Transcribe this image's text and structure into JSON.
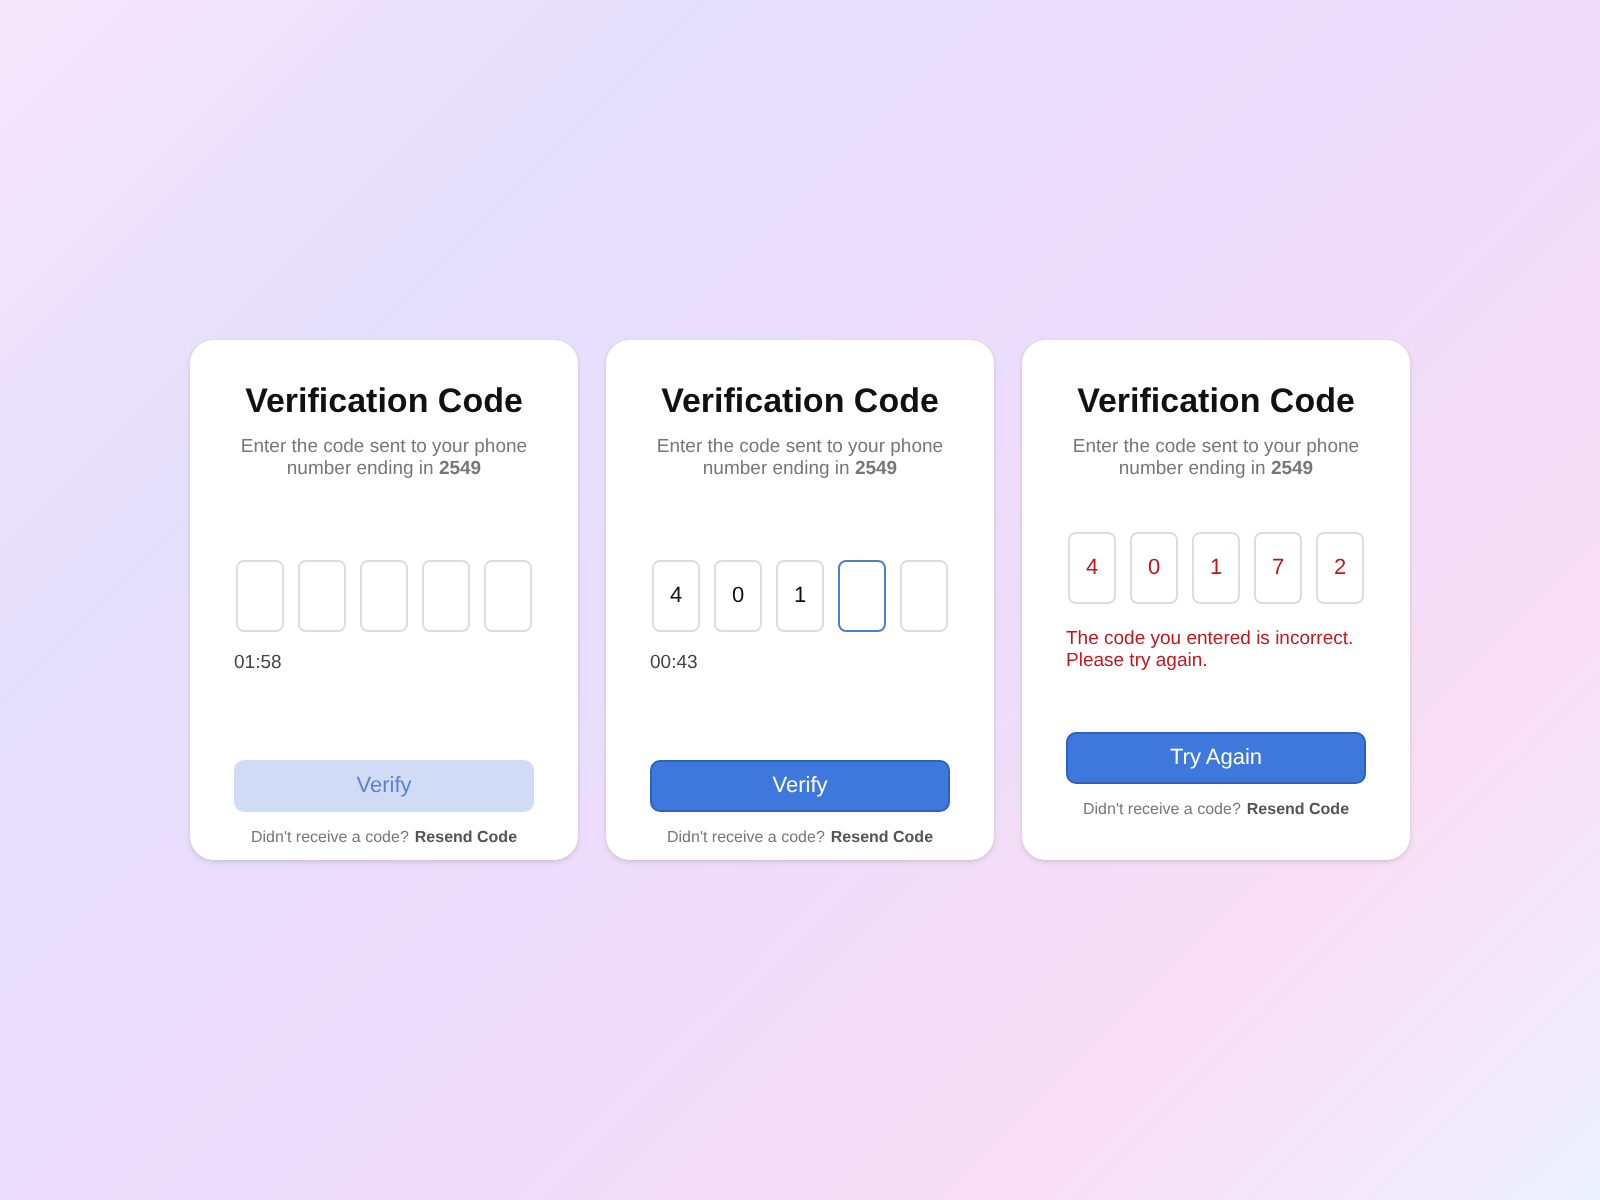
{
  "cards": [
    {
      "title": "Verification Code",
      "subtitle": "Enter the code sent to your phone number ending in **2549**",
      "error": false,
      "digits": [
        {
          "focused": false
        },
        {
          "focused": false
        },
        {
          "focused": false
        },
        {
          "focused": false
        },
        {
          "focused": false
        }
      ],
      "timer": "01:58",
      "button": {
        "label": "Verify",
        "disabled": true
      },
      "footer": {
        "text": "Didn't receive a code?",
        "link": "Resend Code"
      }
    },
    {
      "title": "Verification Code",
      "subtitle": "Enter the code sent to your phone number ending in **2549**",
      "error": false,
      "digits": [
        {
          "value": "4",
          "focused": false
        },
        {
          "value": "0",
          "focused": false
        },
        {
          "value": "1",
          "focused": false
        },
        {
          "focused": true
        },
        {
          "focused": false
        }
      ],
      "timer": "00:43",
      "button": {
        "label": "Verify",
        "disabled": false
      },
      "footer": {
        "text": "Didn't receive a code?",
        "link": "Resend Code"
      }
    },
    {
      "title": "Verification Code",
      "subtitle": "Enter the code sent to your phone number ending in **2549**",
      "error": true,
      "digits": [
        {
          "value": "4",
          "focused": false
        },
        {
          "value": "0",
          "focused": false
        },
        {
          "value": "1",
          "focused": false
        },
        {
          "value": "7",
          "focused": false
        },
        {
          "value": "2",
          "focused": false
        }
      ],
      "error_message": "The code you entered is incorrect. Please try again.",
      "button": {
        "label": "Try Again",
        "disabled": false
      },
      "footer": {
        "text": "Didn't receive a code?",
        "link": "Resend Code"
      }
    }
  ]
}
